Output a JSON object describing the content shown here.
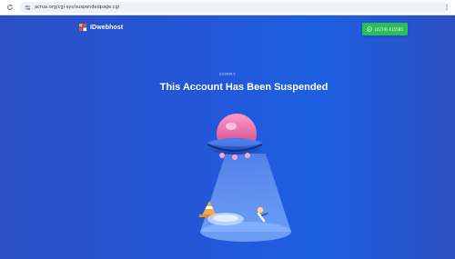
{
  "browser": {
    "url": "acrua.org/cgi-sys/suspendedpage.cgi",
    "icons": {
      "reload": "reload-icon",
      "site_info": "site-info-icon",
      "menu": "more-vert-icon"
    }
  },
  "header": {
    "logo_text": "IDwebhost",
    "whatsapp_label": "(0274) 415585",
    "whatsapp_color": "#2bbd5a"
  },
  "hero": {
    "eyebrow": "SORRY",
    "headline": "This Account Has Been Suspended"
  },
  "colors": {
    "background": "#2357d8",
    "text": "#ffffff"
  }
}
